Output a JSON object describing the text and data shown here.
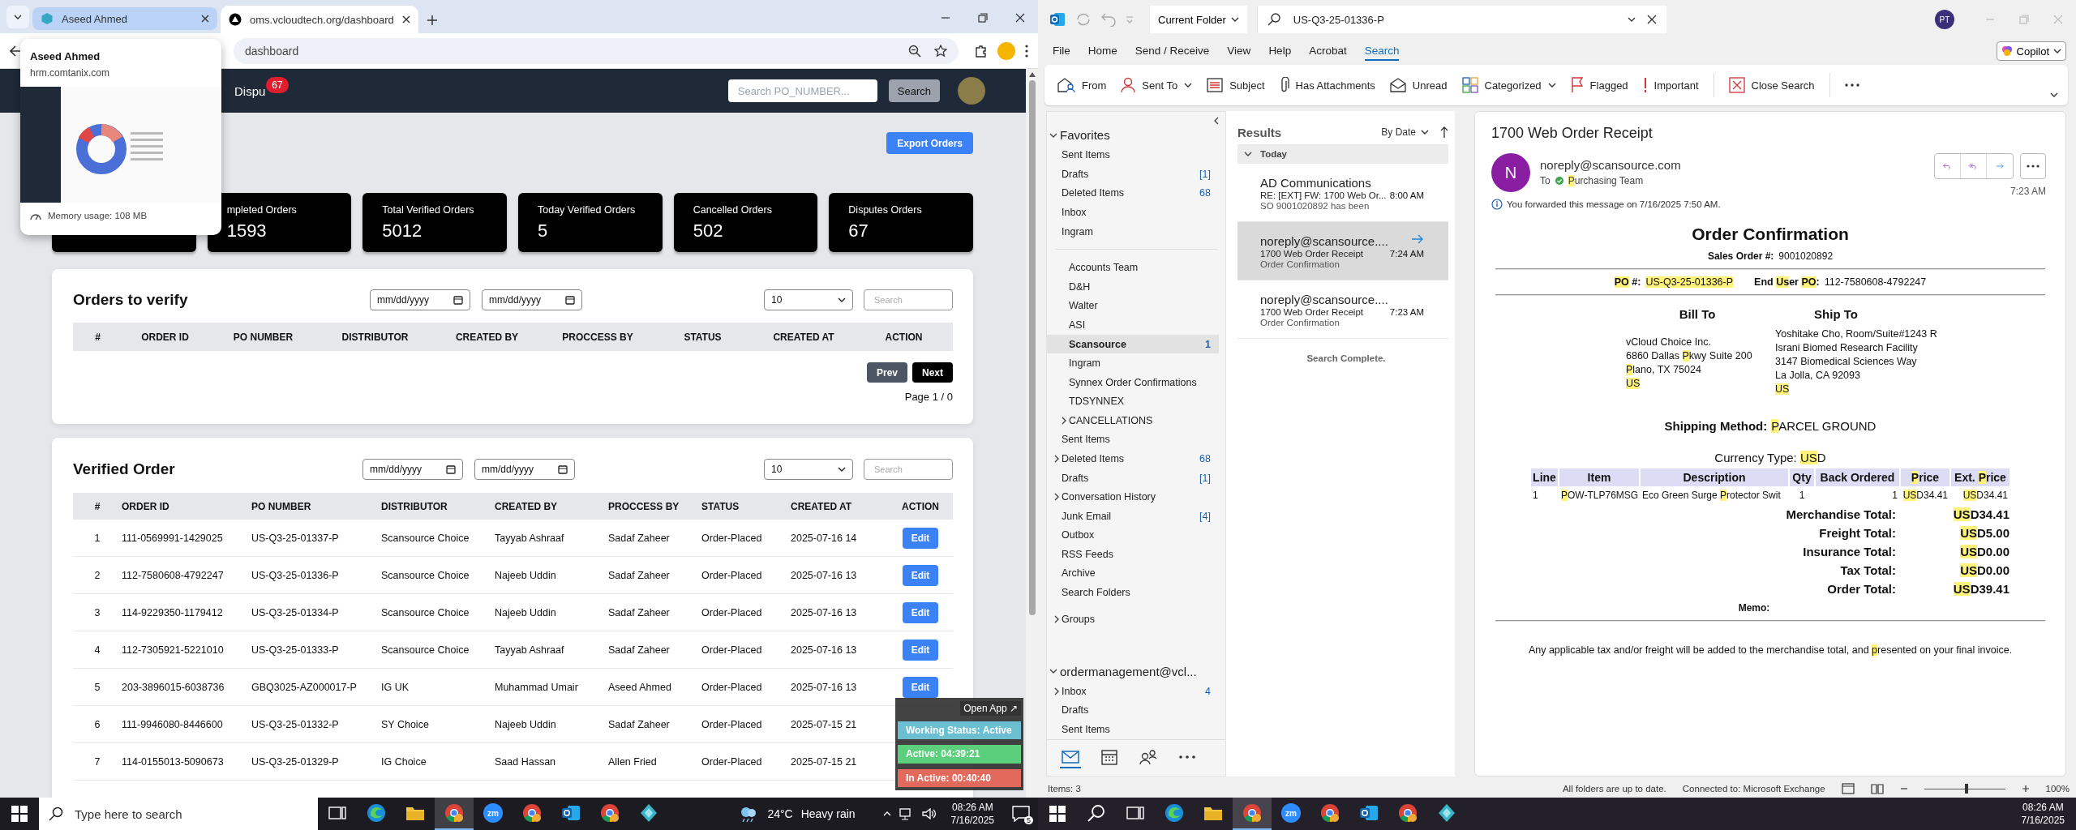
{
  "browser": {
    "tabs": [
      {
        "title": "Aseed Ahmed",
        "selected": false
      },
      {
        "title": "oms.vcloudtech.org/dashboard",
        "selected": true
      }
    ],
    "tab_preview": {
      "title": "Aseed Ahmed",
      "url": "hrm.comtanix.com",
      "memory": "Memory usage: 108 MB"
    },
    "address": "dashboard",
    "page": {
      "header": {
        "nav_label": "Dispu",
        "nav_badge": "67",
        "search_placeholder": "Search PO_NUMBER...",
        "search_button": "Search"
      },
      "export_button": "Export Orders",
      "stats": [
        {
          "label": "mpleted Orders",
          "value": "1593"
        },
        {
          "label": "Total Verified Orders",
          "value": "5012"
        },
        {
          "label": "Today Verified Orders",
          "value": "5"
        },
        {
          "label": "Cancelled Orders",
          "value": "502"
        },
        {
          "label": "Disputes Orders",
          "value": "67"
        }
      ],
      "orders_to_verify": {
        "title": "Orders to verify",
        "date_placeholders": [
          "mm/dd/yyyy",
          "mm/dd/yyyy"
        ],
        "page_size": "10",
        "search_placeholder": "Search",
        "columns": [
          "#",
          "ORDER ID",
          "PO NUMBER",
          "DISTRIBUTOR",
          "CREATED BY",
          "PROCCESS BY",
          "STATUS",
          "CREATED AT",
          "ACTION"
        ],
        "prev": "Prev",
        "next": "Next",
        "page_info": "Page 1 / 0"
      },
      "verified_order": {
        "title": "Verified Order",
        "date_placeholders": [
          "mm/dd/yyyy",
          "mm/dd/yyyy"
        ],
        "page_size": "10",
        "search_placeholder": "Search",
        "columns": [
          "#",
          "ORDER ID",
          "PO NUMBER",
          "DISTRIBUTOR",
          "CREATED BY",
          "PROCCESS BY",
          "STATUS",
          "CREATED AT",
          "ACTION"
        ],
        "rows": [
          {
            "cells": [
              "1",
              "111-0569991-1429025",
              "US-Q3-25-01337-P",
              "Scansource Choice",
              "Tayyab Ashraaf",
              "Sadaf Zaheer",
              "Order-Placed",
              "2025-07-16 14"
            ],
            "action": "Edit"
          },
          {
            "cells": [
              "2",
              "112-7580608-4792247",
              "US-Q3-25-01336-P",
              "Scansource Choice",
              "Najeeb Uddin",
              "Sadaf Zaheer",
              "Order-Placed",
              "2025-07-16 13"
            ],
            "action": "Edit"
          },
          {
            "cells": [
              "3",
              "114-9229350-1179412",
              "US-Q3-25-01334-P",
              "Scansource Choice",
              "Najeeb Uddin",
              "Sadaf Zaheer",
              "Order-Placed",
              "2025-07-16 13"
            ],
            "action": "Edit"
          },
          {
            "cells": [
              "4",
              "112-7305921-5221010",
              "US-Q3-25-01333-P",
              "Scansource Choice",
              "Tayyab Ashraaf",
              "Sadaf Zaheer",
              "Order-Placed",
              "2025-07-16 13"
            ],
            "action": "Edit"
          },
          {
            "cells": [
              "5",
              "203-3896015-6038736",
              "GBQ3025-AZ000017-P",
              "IG UK",
              "Muhammad Umair",
              "Aseed Ahmed",
              "Order-Placed",
              "2025-07-16 13"
            ],
            "action": "Edit"
          },
          {
            "cells": [
              "6",
              "111-9946080-8446600",
              "US-Q3-25-01332-P",
              "SY Choice",
              "Najeeb Uddin",
              "Sadaf Zaheer",
              "Order-Placed",
              "2025-07-15 21"
            ]
          },
          {
            "cells": [
              "7",
              "114-0155013-5090673",
              "US-Q3-25-01329-P",
              "IG Choice",
              "Saad Hassan",
              "Allen Fried",
              "Order-Placed",
              "2025-07-15 21"
            ]
          }
        ]
      },
      "status_widget": {
        "open_app": "Open App ↗",
        "items": [
          {
            "label": "Working Status: Active",
            "color": "#6cbfd0"
          },
          {
            "label": "Active: 04:39:21",
            "color": "#5ccf7c"
          },
          {
            "label": "In Active: 00:40:40",
            "color": "#e3695c"
          }
        ]
      }
    }
  },
  "taskbar_left": {
    "search_placeholder": "Type here to search",
    "apps": [
      {
        "kind": "task-view",
        "active": false
      },
      {
        "kind": "edge",
        "active": false
      },
      {
        "kind": "explorer",
        "active": false
      },
      {
        "kind": "chrome",
        "active": true
      },
      {
        "kind": "zoom",
        "label": "zm",
        "active": false
      },
      {
        "kind": "chrome",
        "active": false
      },
      {
        "kind": "outlook",
        "active": false
      },
      {
        "kind": "chrome",
        "active": false
      },
      {
        "kind": "app",
        "active": false
      }
    ],
    "weather": {
      "temperature": "24°C",
      "condition": "Heavy rain"
    },
    "time": "08:26 AM",
    "date": "7/16/2025",
    "notifications": "5"
  },
  "outlook": {
    "scope": "Current Folder",
    "search_query": "US-Q3-25-01336-P",
    "profile_initials": "PT",
    "menu": [
      {
        "label": "File",
        "selected": false
      },
      {
        "label": "Home",
        "selected": false
      },
      {
        "label": "Send / Receive",
        "selected": false
      },
      {
        "label": "View",
        "selected": false
      },
      {
        "label": "Help",
        "selected": false
      },
      {
        "label": "Acrobat",
        "selected": false
      },
      {
        "label": "Search",
        "selected": true
      }
    ],
    "copilot": "Copilot",
    "ribbon": [
      {
        "kind": "from",
        "label": "From",
        "dropdown": false
      },
      {
        "kind": "sent-to",
        "label": "Sent To",
        "dropdown": true
      },
      {
        "kind": "subject",
        "label": "Subject",
        "dropdown": false
      },
      {
        "kind": "attachment",
        "label": "Has Attachments",
        "dropdown": false
      },
      {
        "kind": "unread",
        "label": "Unread",
        "dropdown": false
      },
      {
        "kind": "categorized",
        "label": "Categorized",
        "dropdown": true
      },
      {
        "kind": "flag",
        "label": "Flagged",
        "dropdown": false
      },
      {
        "kind": "important",
        "label": "Important",
        "dropdown": false
      },
      {
        "kind": "close",
        "label": "Close Search",
        "dropdown": false
      }
    ],
    "favorites": {
      "title": "Favorites",
      "expanded": true,
      "items": [
        {
          "label": "Sent Items",
          "selected": false
        },
        {
          "label": "Drafts",
          "count": "[1]",
          "selected": false
        },
        {
          "label": "Deleted Items",
          "count": "68",
          "selected": false
        },
        {
          "label": "Inbox",
          "selected": false
        },
        {
          "label": "Ingram",
          "selected": false
        }
      ]
    },
    "subfolders": [
      {
        "label": "Accounts Team",
        "selected": false
      },
      {
        "label": "D&H",
        "selected": false
      },
      {
        "label": "Walter",
        "selected": false
      },
      {
        "label": "ASI",
        "selected": false
      },
      {
        "label": "Scansource",
        "count": "1",
        "selected": true
      },
      {
        "label": "Ingram",
        "selected": false
      },
      {
        "label": "Synnex Order Confirmations",
        "selected": false
      },
      {
        "label": "TDSYNNEX",
        "selected": false
      },
      {
        "label": "CANCELLATIONS",
        "expanded": false,
        "selected": false
      }
    ],
    "folders": [
      {
        "label": "Sent Items",
        "selected": false
      },
      {
        "label": "Deleted Items",
        "count": "68",
        "expanded": false,
        "selected": false
      },
      {
        "label": "Drafts",
        "count": "[1]",
        "selected": false
      },
      {
        "label": "Conversation History",
        "expanded": false,
        "selected": false
      },
      {
        "label": "Junk Email",
        "count": "[4]",
        "selected": false
      },
      {
        "label": "Outbox",
        "selected": false
      },
      {
        "label": "RSS Feeds",
        "selected": false
      },
      {
        "label": "Archive",
        "selected": false
      },
      {
        "label": "Search Folders",
        "selected": false
      }
    ],
    "groups": {
      "label": "Groups",
      "expanded": false
    },
    "account": {
      "title": "ordermanagement@vcl...",
      "expanded": true,
      "items": [
        {
          "label": "Inbox",
          "count": "4",
          "expanded": false,
          "selected": false
        },
        {
          "label": "Drafts",
          "selected": false
        },
        {
          "label": "Sent Items",
          "selected": false
        }
      ]
    },
    "nav": [
      {
        "kind": "mail",
        "selected": true
      },
      {
        "kind": "calendar",
        "selected": false
      },
      {
        "kind": "people",
        "selected": false
      },
      {
        "kind": "more",
        "selected": false
      }
    ],
    "results": {
      "title": "Results",
      "sort": "By Date",
      "group": {
        "label": "Today",
        "expanded": true
      },
      "messages": [
        {
          "sender": "AD Communications",
          "subject": "RE: [EXT] FW: 1700 Web Or...",
          "preview": "SO 9001020892 has been",
          "time": "8:00 AM",
          "forwarded": false,
          "selected": false
        },
        {
          "sender": "noreply@scansource....",
          "subject": "1700 Web Order Receipt",
          "preview": "Order Confirmation",
          "time": "7:24 AM",
          "forwarded": true,
          "selected": true
        },
        {
          "sender": "noreply@scansource....",
          "subject": "1700 Web Order Receipt",
          "preview": "Order Confirmation",
          "time": "7:23 AM",
          "forwarded": false,
          "selected": false
        }
      ],
      "footer": "Search Complete."
    },
    "message": {
      "subject": "1700 Web Order Receipt",
      "sender_initial": "N",
      "sender": "noreply@scansource.com",
      "to_label": "To",
      "recipient": [
        {
          "text": "P",
          "highlighted": true
        },
        {
          "text": "urchasing Team",
          "highlighted": false
        }
      ],
      "time": "7:23 AM",
      "forward_note": "You forwarded this message on 7/16/2025 7:50 AM.",
      "body": {
        "heading": "Order Confirmation",
        "sales_order_label": "Sales Order #:",
        "sales_order": "9001020892",
        "po_label": [
          {
            "text": "PO",
            "highlighted": true
          },
          {
            "text": " #:",
            "highlighted": false
          }
        ],
        "po": [
          {
            "text": "US-Q3-25-01336-P",
            "highlighted": true
          }
        ],
        "end_user_label": [
          {
            "text": "End ",
            "highlighted": false
          },
          {
            "text": "Us",
            "highlighted": true
          },
          {
            "text": "er ",
            "highlighted": false
          },
          {
            "text": "PO",
            "highlighted": true
          },
          {
            "text": ":",
            "highlighted": false
          }
        ],
        "end_user_po": "112-7580608-4792247",
        "bill_to": {
          "title": "Bill To",
          "lines": [
            "vCloud Choice Inc.",
            [
              {
                "text": "6860 Dallas ",
                "highlighted": false
              },
              {
                "text": "P",
                "highlighted": true
              },
              {
                "text": "kwy Suite 200",
                "highlighted": false
              }
            ],
            [
              {
                "text": "P",
                "highlighted": true
              },
              {
                "text": "lano, TX 75024",
                "highlighted": false
              }
            ],
            [
              {
                "text": "US",
                "highlighted": true
              }
            ]
          ]
        },
        "ship_to": {
          "title": "Ship To",
          "lines": [
            "Yoshitake Cho, Room/Suite#1243 R",
            "Israni Biomed Research Facility",
            "3147 Biomedical Sciences Way",
            "La Jolla, CA 92093",
            [
              {
                "text": "US",
                "highlighted": true
              }
            ]
          ]
        },
        "shipping_label": "Shipping Method:",
        "shipping": [
          {
            "text": "P",
            "highlighted": true
          },
          {
            "text": "ARCEL GROUND",
            "highlighted": false
          }
        ],
        "currency": [
          {
            "text": "Currency Type: ",
            "highlighted": false
          },
          {
            "text": "US",
            "highlighted": true
          },
          {
            "text": "D",
            "highlighted": false
          }
        ],
        "columns": [
          "Line",
          "Item",
          "Description",
          "Qty",
          "Back Ordered",
          [
            {
              "text": "P",
              "highlighted": true
            },
            {
              "text": "rice",
              "highlighted": false
            }
          ],
          [
            {
              "text": "Ext. ",
              "highlighted": false
            },
            {
              "text": "P",
              "highlighted": true
            },
            {
              "text": "rice",
              "highlighted": false
            }
          ]
        ],
        "lines": [
          {
            "cells": [
              "1",
              [
                {
                  "text": "P",
                  "highlighted": true
                },
                {
                  "text": "OW-TLP76MSG",
                  "highlighted": false
                }
              ],
              [
                {
                  "text": "Eco Green Surge ",
                  "highlighted": false
                },
                {
                  "text": "P",
                  "highlighted": true
                },
                {
                  "text": "rotector Swit",
                  "highlighted": false
                }
              ],
              "1",
              "1",
              [
                {
                  "text": "US",
                  "highlighted": true
                },
                {
                  "text": "D34.41",
                  "highlighted": false
                }
              ],
              [
                {
                  "text": "US",
                  "highlighted": true
                },
                {
                  "text": "D34.41",
                  "highlighted": false
                }
              ]
            ]
          }
        ],
        "totals": [
          {
            "label": "Merchandise Total:",
            "value": [
              {
                "text": "US",
                "highlighted": true
              },
              {
                "text": "D34.41",
                "highlighted": false
              }
            ]
          },
          {
            "label": "Freight Total:",
            "value": [
              {
                "text": "US",
                "highlighted": true
              },
              {
                "text": "D5.00",
                "highlighted": false
              }
            ]
          },
          {
            "label": "Insurance Total:",
            "value": [
              {
                "text": "US",
                "highlighted": true
              },
              {
                "text": "D0.00",
                "highlighted": false
              }
            ]
          },
          {
            "label": "Tax Total:",
            "value": [
              {
                "text": "US",
                "highlighted": true
              },
              {
                "text": "D0.00",
                "highlighted": false
              }
            ]
          },
          {
            "label": "Order Total:",
            "value": [
              {
                "text": "US",
                "highlighted": true
              },
              {
                "text": "D39.41",
                "highlighted": false
              }
            ]
          }
        ],
        "memo_label": "Memo:",
        "footer": [
          {
            "text": "Any applicable tax and/or freight will be added to the merchandise total, and ",
            "highlighted": false
          },
          {
            "text": "p",
            "highlighted": true
          },
          {
            "text": "resented on your final invoice.",
            "highlighted": false
          }
        ]
      }
    },
    "status_bar": {
      "items": "Items: 3",
      "sync": "All folders are up to date.",
      "connection": "Connected to: Microsoft Exchange",
      "zoom_slider": {
        "level": 0.5
      },
      "zoom": "100%"
    }
  },
  "taskbar_right": {
    "apps": [
      {
        "kind": "task-view",
        "active": false
      },
      {
        "kind": "edge",
        "active": false
      },
      {
        "kind": "explorer",
        "active": false
      },
      {
        "kind": "chrome",
        "active": true
      },
      {
        "kind": "zoom",
        "label": "zm",
        "active": false
      },
      {
        "kind": "chrome",
        "active": false
      },
      {
        "kind": "outlook",
        "active": false
      },
      {
        "kind": "chrome",
        "active": false
      },
      {
        "kind": "app",
        "active": false
      }
    ],
    "time": "08:26 AM",
    "date": "7/16/2025"
  }
}
